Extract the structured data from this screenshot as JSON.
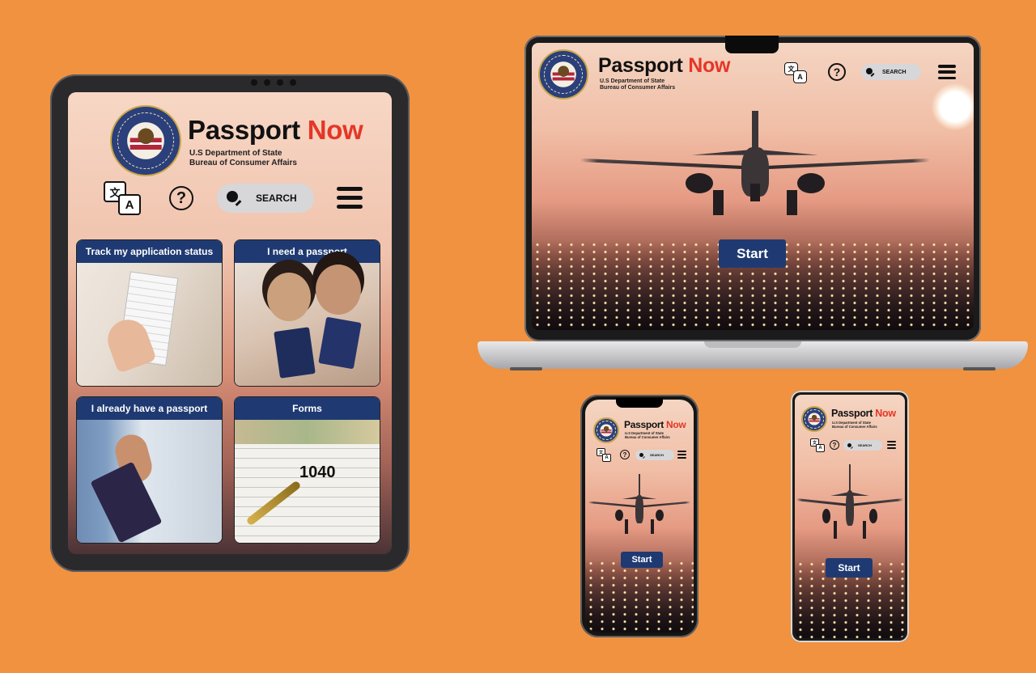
{
  "brand": {
    "title_main": "Passport",
    "title_accent": "Now",
    "department": "U.S Department of State",
    "bureau": "Bureau of Consumer Affairs",
    "accent_color": "#E53627",
    "primary_color": "#1F3A72",
    "background_color": "#F09240"
  },
  "toolbar": {
    "translate_glyph_1": "文",
    "translate_glyph_2": "A",
    "help_glyph": "?",
    "search_label": "SEARCH"
  },
  "tablet": {
    "cards": [
      {
        "label": "Track my application status"
      },
      {
        "label": "I need a passport"
      },
      {
        "label": "I already have a passport"
      },
      {
        "label": "Forms"
      }
    ],
    "forms_image_text": "1040"
  },
  "laptop": {
    "start_label": "Start"
  },
  "phone1": {
    "start_label": "Start"
  },
  "phone2": {
    "start_label": "Start"
  }
}
